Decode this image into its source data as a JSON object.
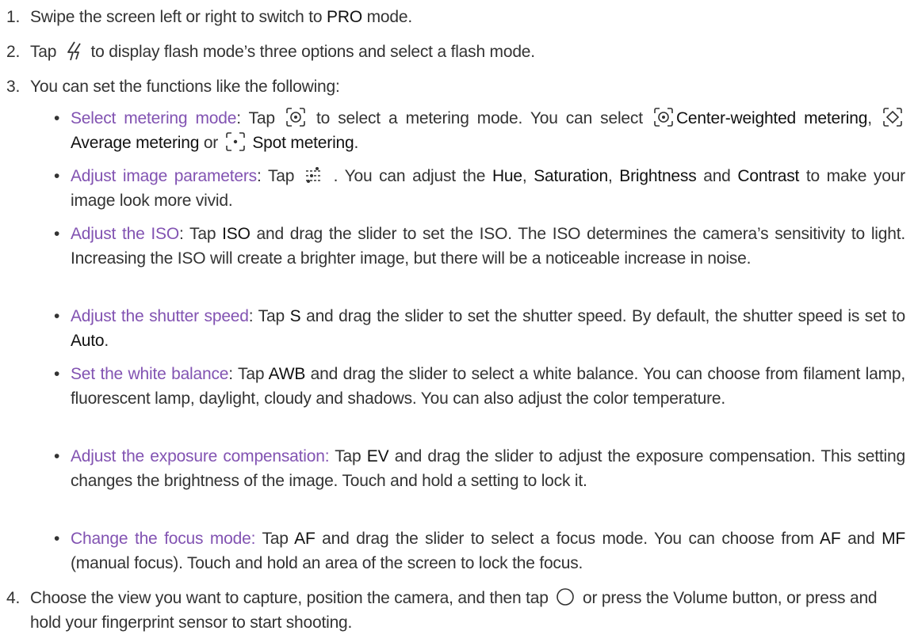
{
  "colors": {
    "accent": "#8253b2",
    "text": "#333333",
    "keyword": "#111111"
  },
  "icons": {
    "flash": "flash-icon",
    "center_metering": "center-weighted-metering-icon",
    "average_metering": "average-metering-icon",
    "spot_metering": "spot-metering-icon",
    "adjust": "image-parameters-icon",
    "shutter": "shutter-button-icon"
  },
  "steps": [
    {
      "num": "1.",
      "a": "Swipe the screen left or right to switch to ",
      "b": "PRO",
      "c": " mode."
    },
    {
      "num": "2.",
      "a": "Tap ",
      "b": " to display flash mode’s three options and select a flash mode."
    },
    {
      "num": "3.",
      "a": "You can set the functions like the following:"
    },
    {
      "num": "4.",
      "a": "Choose the view you want to capture, position the camera, and then tap ",
      "b": " or press the Volume button, or press and hold your fingerprint sensor to start shooting."
    }
  ],
  "bullets": {
    "metering": {
      "title": "Select metering mode",
      "t1": ": Tap ",
      "t2": " to select a metering mode. You can select ",
      "k1": "Center-weighted metering",
      "t3": ", ",
      "k2": " Average metering",
      "t4": " or ",
      "k3": " Spot metering",
      "t5": "."
    },
    "image": {
      "title": "Adjust image parameters",
      "t1": ": Tap ",
      "t2": " . You can adjust the ",
      "k1": "Hue",
      "t3": ", ",
      "k2": "Saturation",
      "t4": ", ",
      "k3": "Brightness",
      "t5": " and ",
      "k4": "Contrast",
      "t6": " to make your image look more vivid."
    },
    "iso": {
      "title": "Adjust the ISO",
      "t1": ": Tap ",
      "k1": "ISO",
      "t2": " and drag the slider to set the ISO. The ISO determines the camera’s sensitivity to light. Increasing the ISO will create a brighter image, but there will be a noticeable increase in noise."
    },
    "shutter": {
      "title": "Adjust the shutter speed",
      "t1": ": Tap ",
      "k1": "S",
      "t2": " and drag the slider to set the shutter speed. By default, the shutter speed is set to ",
      "k2": "Auto",
      "t3": "."
    },
    "wb": {
      "title": "Set the white balance",
      "t1": ": Tap ",
      "k1": "AWB",
      "t2": " and drag the slider to select a white balance. You can choose from filament lamp, fluorescent lamp, daylight, cloudy and shadows. You can also adjust the color temperature."
    },
    "ev": {
      "title": "Adjust the exposure compensation:",
      "t1": " Tap ",
      "k1": "EV",
      "t2": " and drag the slider to adjust the exposure compensation. This setting changes the brightness of the image. Touch and hold a setting to lock it."
    },
    "af": {
      "title": "Change the focus mode:",
      "t1": " Tap ",
      "k1": "AF",
      "t2": " and drag the slider to select a focus mode. You can choose from ",
      "k2": "AF",
      "t3": " and ",
      "k3": "MF",
      "t4": " (manual focus). Touch and hold an area of the screen to lock the focus."
    }
  }
}
